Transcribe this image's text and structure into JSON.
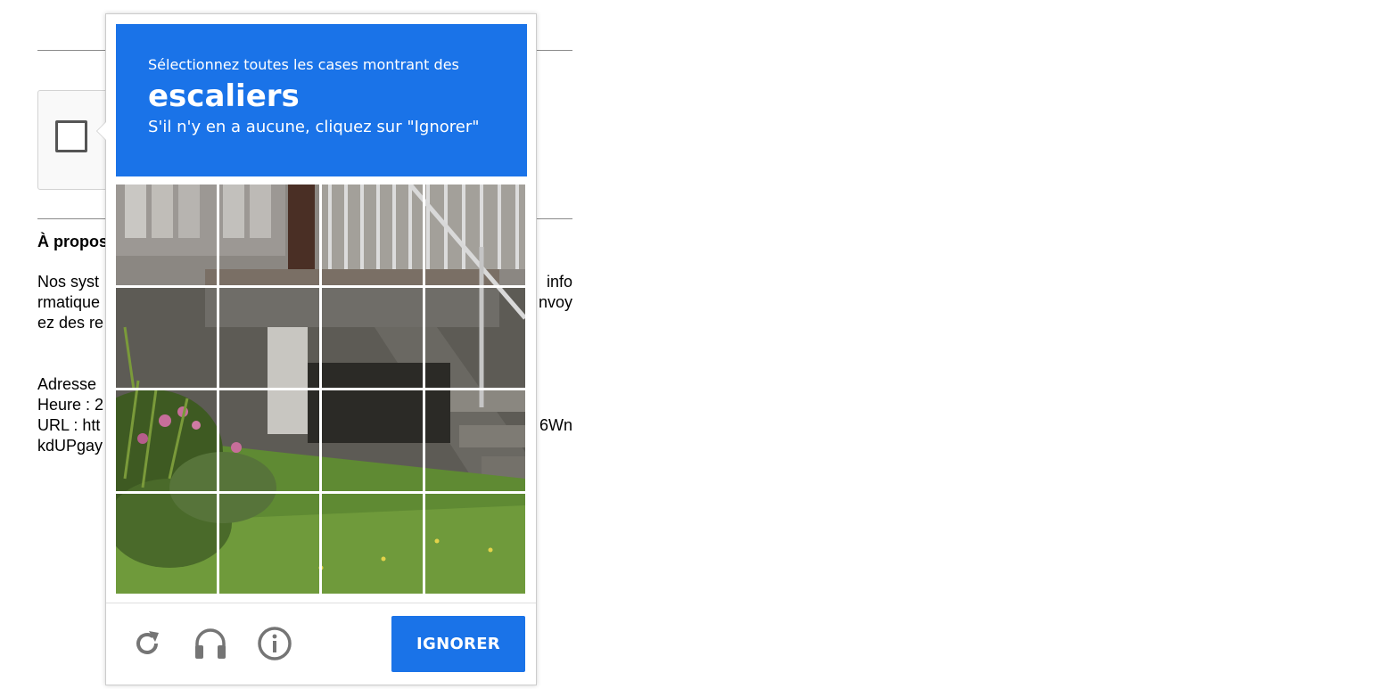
{
  "page": {
    "about_heading": "À propos",
    "systems_lines": [
      "Nos syst",
      "rmatique",
      "ez des re"
    ],
    "details_lines": [
      "Adresse",
      "Heure : 2",
      "URL : htt",
      "kdUPgay"
    ],
    "right_fragments": {
      "info": "info",
      "nvoy": "nvoy",
      "wn": "6Wn"
    }
  },
  "challenge": {
    "instruction": "Sélectionnez toutes les cases montrant des",
    "keyword": "escaliers",
    "subinstruction": "S'il n'y en a aucune, cliquez sur \"Ignorer\"",
    "skip_label": "IGNORER",
    "grid": {
      "rows": 4,
      "cols": 4,
      "selected_tiles": []
    },
    "icons": [
      "reload-icon",
      "headphones-icon",
      "info-icon"
    ]
  },
  "colors": {
    "accent": "#1a73e8",
    "icon_gray": "#757575"
  }
}
